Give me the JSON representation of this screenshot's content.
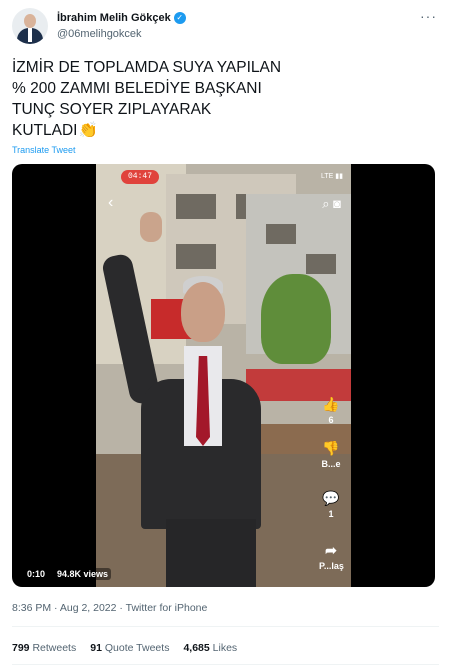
{
  "author": {
    "name": "İbrahim Melih Gökçek",
    "handle": "@06melihgokcek",
    "verified_icon": "✓",
    "more_label": "···"
  },
  "tweet": {
    "lines": [
      "İZMİR DE TOPLAMDA SUYA YAPILAN",
      "% 200 ZAMMI BELEDİYE BAŞKANI",
      "TUNÇ SOYER ZIPLAYARAK",
      "KUTLADI"
    ],
    "emoji": "👏",
    "translate_label": "Translate Tweet"
  },
  "video": {
    "rec_label": "04:47",
    "status": "LTE ▮▮",
    "back_icon": "‹",
    "tools_icons": "⌕ ◙",
    "actions": [
      {
        "icon": "👍",
        "label": "6"
      },
      {
        "icon": "👎",
        "label": "B...e"
      },
      {
        "icon": "💬",
        "label": "1"
      },
      {
        "icon": "➦",
        "label": "P...laş"
      }
    ],
    "elapsed": "0:10",
    "views": "94.8K views"
  },
  "meta": {
    "timestamp": "8:36 PM · Aug 2, 2022 · Twitter for iPhone"
  },
  "stats": [
    {
      "count": "799",
      "label": "Retweets"
    },
    {
      "count": "91",
      "label": "Quote Tweets"
    },
    {
      "count": "4,685",
      "label": "Likes"
    }
  ],
  "colors": {
    "link": "#1d9bf0",
    "secondary_text": "#536471",
    "primary_text": "#0f1419"
  }
}
